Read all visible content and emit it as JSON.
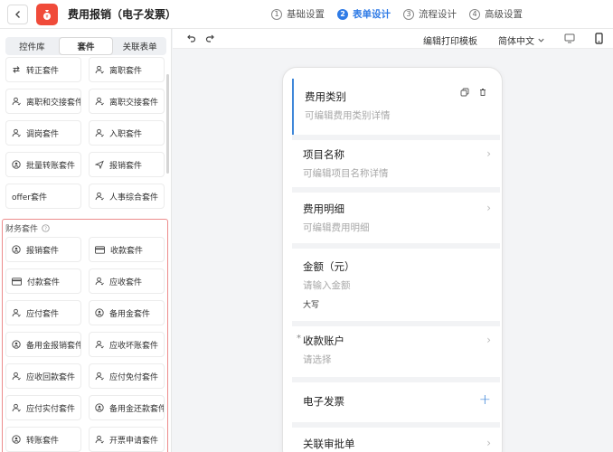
{
  "header": {
    "title": "费用报销（电子发票）",
    "steps": [
      {
        "num": "1",
        "label": "基础设置"
      },
      {
        "num": "2",
        "label": "表单设计"
      },
      {
        "num": "3",
        "label": "流程设计"
      },
      {
        "num": "4",
        "label": "高级设置"
      }
    ]
  },
  "left": {
    "tabs": [
      "控件库",
      "套件",
      "关联表单"
    ],
    "kits": [
      {
        "label": "转正套件",
        "icon": "switch-icon"
      },
      {
        "label": "离职套件",
        "icon": "user-icon"
      },
      {
        "label": "离职和交接套件",
        "icon": "user-icon"
      },
      {
        "label": "离职交接套件",
        "icon": "user-icon"
      },
      {
        "label": "调岗套件",
        "icon": "user-icon"
      },
      {
        "label": "入职套件",
        "icon": "user-icon"
      },
      {
        "label": "批量转账套件",
        "icon": "circle-user-icon"
      },
      {
        "label": "报销套件",
        "icon": "plane-icon"
      },
      {
        "label": "offer套件",
        "icon": ""
      },
      {
        "label": "人事综合套件",
        "icon": "user-icon"
      }
    ],
    "finance_title": "财务套件",
    "finance_kits": [
      {
        "label": "报销套件",
        "icon": "circle-user-icon"
      },
      {
        "label": "收款套件",
        "icon": "card-icon"
      },
      {
        "label": "付款套件",
        "icon": "card-icon"
      },
      {
        "label": "应收套件",
        "icon": "user-icon"
      },
      {
        "label": "应付套件",
        "icon": "user-icon"
      },
      {
        "label": "备用金套件",
        "icon": "circle-user-icon"
      },
      {
        "label": "备用金报销套件",
        "icon": "circle-user-icon"
      },
      {
        "label": "应收坏账套件",
        "icon": "user-icon"
      },
      {
        "label": "应收回款套件",
        "icon": "user-icon"
      },
      {
        "label": "应付免付套件",
        "icon": "user-icon"
      },
      {
        "label": "应付实付套件",
        "icon": "user-icon"
      },
      {
        "label": "备用金还款套件",
        "icon": "circle-user-icon"
      },
      {
        "label": "转账套件",
        "icon": "circle-user-icon"
      },
      {
        "label": "开票申请套件",
        "icon": "user-icon"
      }
    ]
  },
  "toolbar": {
    "print_label": "编辑打印模板",
    "lang_label": "简体中文"
  },
  "form": {
    "fields": [
      {
        "label": "费用类别",
        "hint": "可编辑费用类别详情"
      },
      {
        "label": "项目名称",
        "hint": "可编辑项目名称详情"
      },
      {
        "label": "费用明细",
        "hint": "可编辑费用明细"
      },
      {
        "label": "金额（元）",
        "hint": "请输入金额",
        "extra": "大写"
      },
      {
        "label": "收款账户",
        "hint": "请选择"
      },
      {
        "label": "电子发票"
      },
      {
        "label": "关联审批单"
      }
    ]
  },
  "colors": {
    "accent": "#2f7be6",
    "app_icon": "#f04b3a",
    "highlight_border": "#ec8c8c"
  }
}
